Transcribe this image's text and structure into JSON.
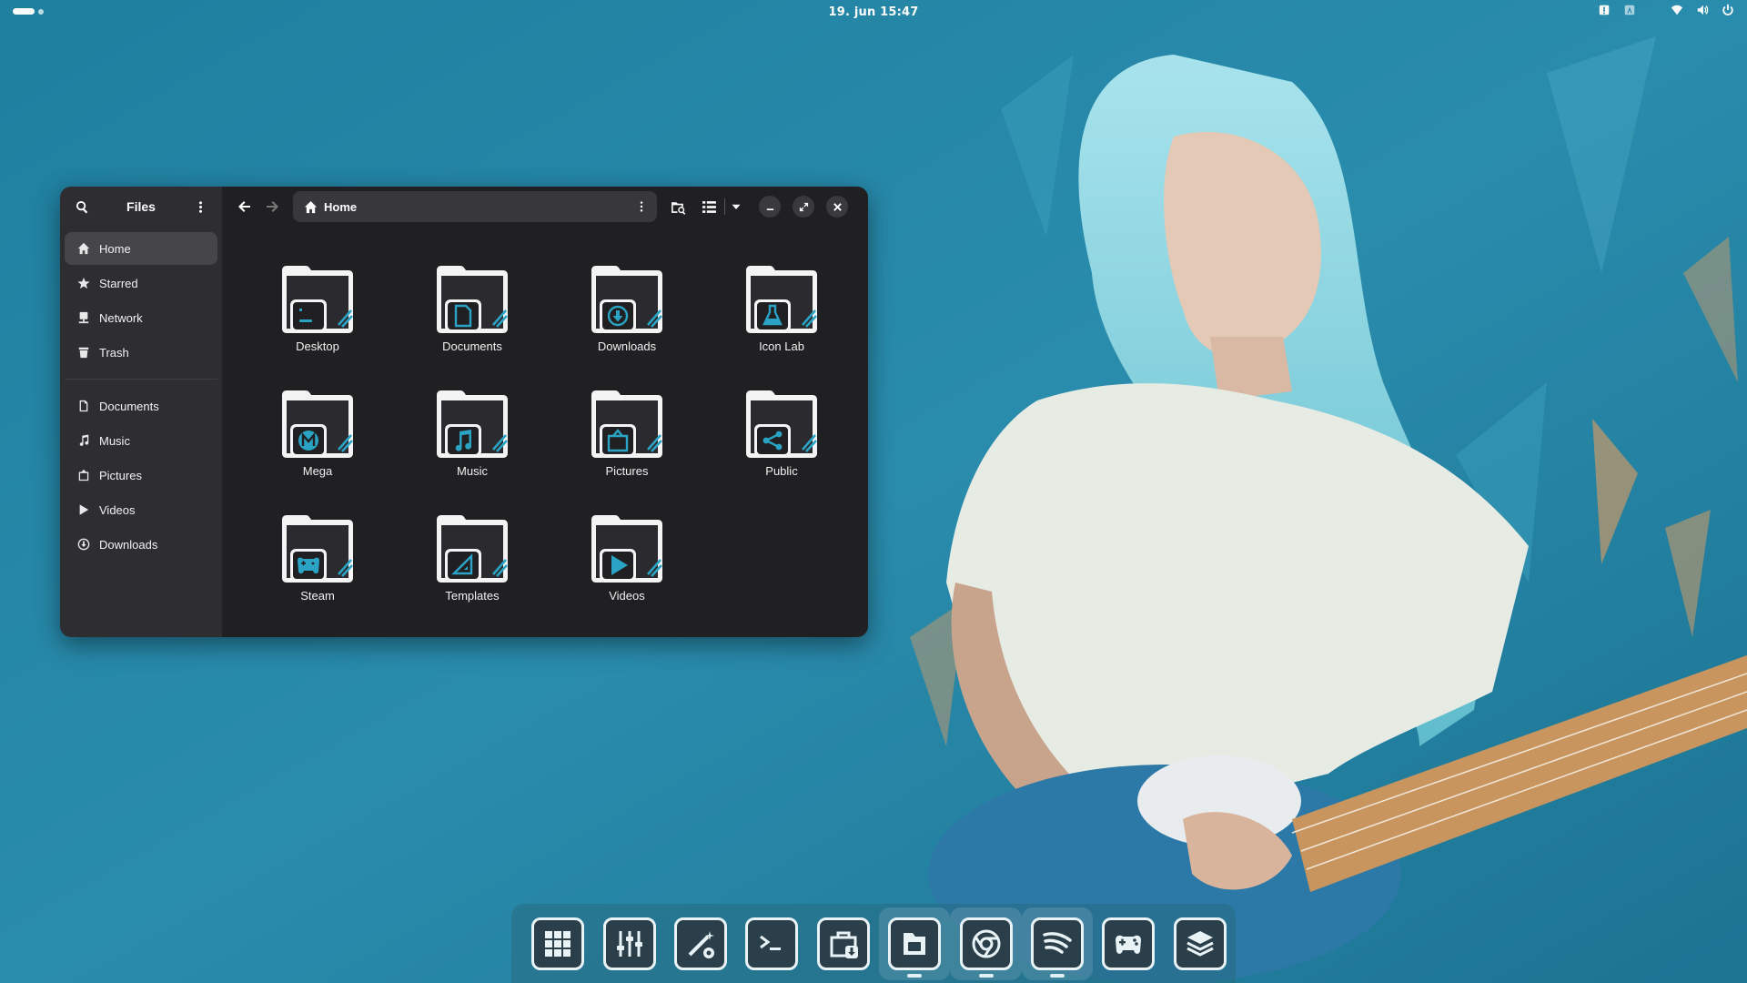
{
  "topbar": {
    "clock": "19. jun  15:47",
    "tray_icons": [
      "notification-icon",
      "keyboard-icon",
      "wifi-icon",
      "volume-icon",
      "power-icon"
    ]
  },
  "window": {
    "sidebar": {
      "title": "Files",
      "places": [
        {
          "label": "Home",
          "icon": "home-icon",
          "active": true
        },
        {
          "label": "Starred",
          "icon": "star-icon"
        },
        {
          "label": "Network",
          "icon": "network-icon"
        },
        {
          "label": "Trash",
          "icon": "trash-icon"
        }
      ],
      "bookmarks": [
        {
          "label": "Documents",
          "icon": "document-icon"
        },
        {
          "label": "Music",
          "icon": "music-icon"
        },
        {
          "label": "Pictures",
          "icon": "picture-icon"
        },
        {
          "label": "Videos",
          "icon": "video-icon"
        },
        {
          "label": "Downloads",
          "icon": "download-icon"
        }
      ]
    },
    "pathbar": {
      "label": "Home"
    },
    "folders": [
      {
        "label": "Desktop",
        "emblem": "terminal"
      },
      {
        "label": "Documents",
        "emblem": "document"
      },
      {
        "label": "Downloads",
        "emblem": "download"
      },
      {
        "label": "Icon Lab",
        "emblem": "flask"
      },
      {
        "label": "Mega",
        "emblem": "mega"
      },
      {
        "label": "Music",
        "emblem": "music"
      },
      {
        "label": "Pictures",
        "emblem": "picture"
      },
      {
        "label": "Public",
        "emblem": "share"
      },
      {
        "label": "Steam",
        "emblem": "gamepad"
      },
      {
        "label": "Templates",
        "emblem": "template"
      },
      {
        "label": "Videos",
        "emblem": "play"
      }
    ]
  },
  "dock": {
    "apps": [
      {
        "icon": "app-grid-icon",
        "running": false
      },
      {
        "icon": "mixer-icon",
        "running": false
      },
      {
        "icon": "tweaks-icon",
        "running": false
      },
      {
        "icon": "terminal-icon",
        "running": false
      },
      {
        "icon": "software-icon",
        "running": false
      },
      {
        "icon": "files-icon",
        "running": true
      },
      {
        "icon": "chrome-icon",
        "running": true
      },
      {
        "icon": "spotify-icon",
        "running": true
      },
      {
        "icon": "games-icon",
        "running": false
      },
      {
        "icon": "layers-icon",
        "running": false
      }
    ]
  },
  "colors": {
    "wallpaper": "#2a8cad",
    "sidebar": "#2e2e32",
    "content": "#202023",
    "accent_teal": "#2aa3c4"
  }
}
